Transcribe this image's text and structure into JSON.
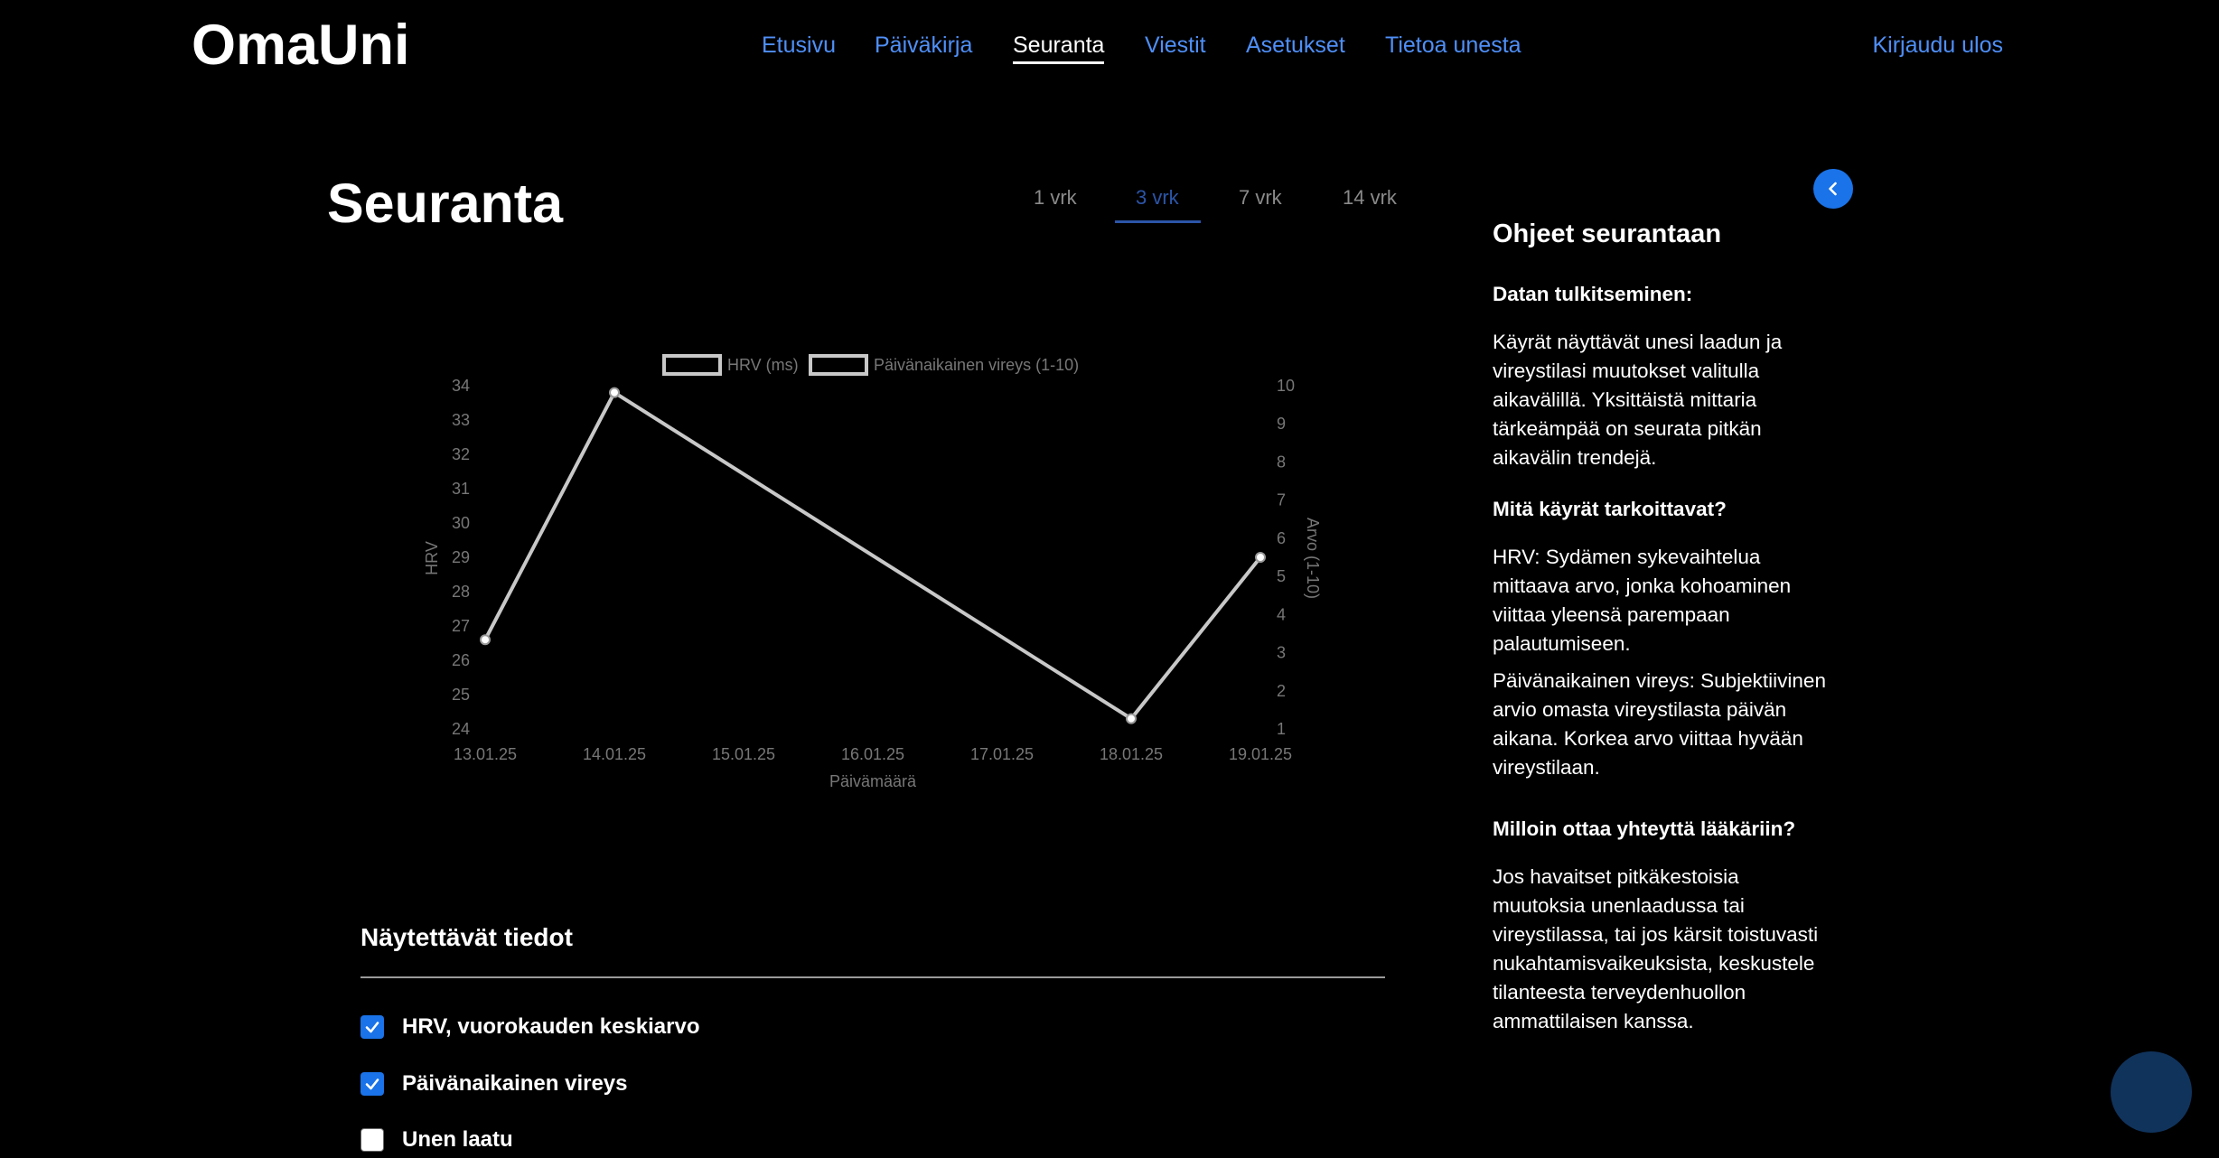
{
  "brand": {
    "logo": "OmaUni"
  },
  "nav": {
    "items": [
      {
        "label": "Etusivu"
      },
      {
        "label": "Päiväkirja"
      },
      {
        "label": "Seuranta"
      },
      {
        "label": "Viestit"
      },
      {
        "label": "Asetukset"
      },
      {
        "label": "Tietoa unesta"
      }
    ],
    "active": "Seuranta",
    "logout": "Kirjaudu ulos"
  },
  "page": {
    "title": "Seuranta"
  },
  "range_tabs": {
    "items": [
      {
        "label": "1 vrk"
      },
      {
        "label": "3 vrk"
      },
      {
        "label": "7 vrk"
      },
      {
        "label": "14 vrk"
      }
    ],
    "active": "3 vrk"
  },
  "chart_data": {
    "type": "line",
    "x": [
      "13.01.25",
      "14.01.25",
      "15.01.25",
      "16.01.25",
      "17.01.25",
      "18.01.25",
      "19.01.25"
    ],
    "series": [
      {
        "name": "HRV (ms)",
        "axis": "left",
        "x": [
          "13.01.25",
          "14.01.25",
          "18.01.25",
          "19.01.25"
        ],
        "values": [
          26.6,
          33.8,
          24.3,
          29.0
        ]
      },
      {
        "name": "Päivänaikainen vireys (1-10)",
        "axis": "right",
        "x": [],
        "values": []
      }
    ],
    "xlabel": "Päivämäärä",
    "ylabel_left": "HRV",
    "ylabel_right": "Arvo (1-10)",
    "ylim_left": [
      24,
      34
    ],
    "ylim_right": [
      1,
      10
    ],
    "yticks_left": [
      "24",
      "25",
      "26",
      "27",
      "28",
      "29",
      "30",
      "31",
      "32",
      "33",
      "34"
    ],
    "yticks_right": [
      "1",
      "2",
      "3",
      "4",
      "5",
      "6",
      "7",
      "8",
      "9",
      "10"
    ],
    "legend_position": "top",
    "grid": false,
    "line_color": "#c8c8c8"
  },
  "options": {
    "title": "Näytettävät tiedot",
    "items": [
      {
        "label": "HRV, vuorokauden keskiarvo",
        "checked": true
      },
      {
        "label": "Päivänaikainen vireys",
        "checked": true
      },
      {
        "label": "Unen laatu",
        "checked": false
      }
    ]
  },
  "sidebar": {
    "title": "Ohjeet seurantaan",
    "sections": [
      {
        "heading": "Datan tulkitseminen:",
        "paragraphs": [
          "Käyrät näyttävät unesi laadun ja vireystilasi muutokset valitulla aikavälillä. Yksittäistä mittaria tärkeämpää on seurata pitkän aikavälin trendejä."
        ]
      },
      {
        "heading": "Mitä käyrät tarkoittavat?",
        "paragraphs": [
          "HRV: Sydämen sykevaihtelua mittaava arvo, jonka kohoaminen viittaa yleensä parempaan palautumiseen.",
          "Päivänaikainen vireys: Subjektiivinen arvio omasta vireystilasta päivän aikana. Korkea arvo viittaa hyvään vireystilaan."
        ]
      },
      {
        "heading": "Milloin ottaa yhteyttä lääkäriin?",
        "paragraphs": [
          "Jos havaitset pitkäkestoisia muutoksia unenlaadussa tai vireystilassa, tai jos kärsit toistuvasti nukahtamisvaikeuksista, keskustele tilanteesta terveydenhuollon ammattilaisen kanssa."
        ]
      }
    ]
  },
  "colors": {
    "accent": "#1a73e8",
    "nav_link": "#4f8ff7",
    "active_tab": "#2b55a8",
    "chat_bubble": "#10335c"
  },
  "icons": {
    "collapse": "chevron-left-icon",
    "checkbox": "check-icon",
    "chat": "chat-bubble-icon"
  }
}
